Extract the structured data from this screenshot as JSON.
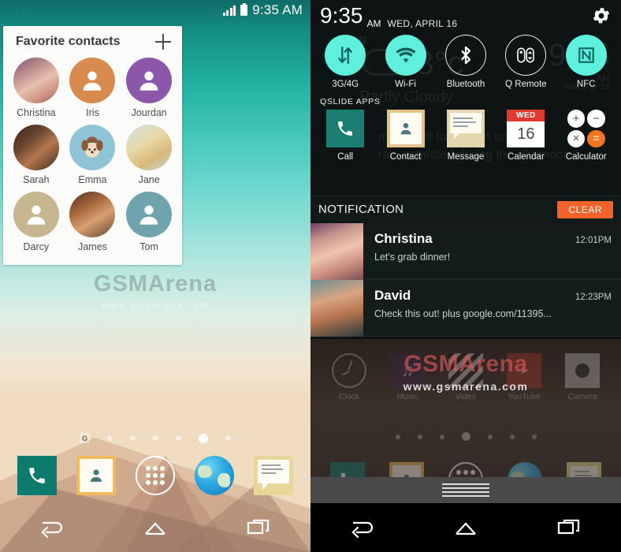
{
  "left_screen": {
    "statusbar": {
      "time": "9:35 AM",
      "signal_icon": "signal-bars-icon",
      "battery_icon": "battery-icon"
    },
    "widget": {
      "title": "Favorite contacts",
      "add_icon": "plus-icon",
      "contacts": [
        {
          "name": "Christina",
          "type": "photo",
          "photo_class": "ph-christina",
          "color": "#b98d8c"
        },
        {
          "name": "Iris",
          "type": "silhouette",
          "color": "#d98b4e"
        },
        {
          "name": "Jourdan",
          "type": "silhouette",
          "color": "#8c57ab"
        },
        {
          "name": "Sarah",
          "type": "photo",
          "photo_class": "ph-sarah",
          "color": "#6b4630"
        },
        {
          "name": "Emma",
          "type": "photo",
          "photo_class": "ph-emma",
          "color": "#8fc4d6"
        },
        {
          "name": "Jane",
          "type": "photo",
          "photo_class": "ph-jane",
          "color": "#d9b978"
        },
        {
          "name": "Darcy",
          "type": "silhouette",
          "color": "#c5b68f"
        },
        {
          "name": "James",
          "type": "photo",
          "photo_class": "ph-james",
          "color": "#a9683d"
        },
        {
          "name": "Tom",
          "type": "silhouette",
          "color": "#6fa3ae"
        }
      ]
    },
    "page_indicator": {
      "google_badge": "G",
      "dot_count": 6,
      "active_index": 5
    },
    "dock": [
      {
        "name": "phone",
        "icon": "phone-icon"
      },
      {
        "name": "contacts",
        "icon": "contact-icon"
      },
      {
        "name": "app-drawer",
        "icon": "app-drawer-icon"
      },
      {
        "name": "browser",
        "icon": "globe-icon"
      },
      {
        "name": "messages",
        "icon": "message-icon"
      }
    ],
    "navbar": [
      {
        "name": "back",
        "icon": "back-arrow-icon"
      },
      {
        "name": "home",
        "icon": "home-icon"
      },
      {
        "name": "recents",
        "icon": "recent-apps-icon"
      }
    ],
    "watermark": {
      "big": "GSMArena",
      "small": "www.gsmarena.com"
    }
  },
  "right_screen": {
    "header": {
      "time": "9:35",
      "ampm": "AM",
      "date": "WED, APRIL 16",
      "settings_icon": "gear-icon"
    },
    "ghost_widget": {
      "on": "ON",
      "temp": "13°c",
      "condition": "Partly Cloudy",
      "time": "9:35",
      "ampm": "AM",
      "date": "Wed, Apr 16",
      "line1": "may want to take an umbrella",
      "line2": "rain expected during the afternoon"
    },
    "toggles": [
      {
        "label": "3G/4G",
        "icon": "data-transfer-icon",
        "state": "on"
      },
      {
        "label": "Wi-Fi",
        "icon": "wifi-icon",
        "state": "on"
      },
      {
        "label": "Bluetooth",
        "icon": "bluetooth-icon",
        "state": "off"
      },
      {
        "label": "Q Remote",
        "icon": "remote-control-icon",
        "state": "off"
      },
      {
        "label": "NFC",
        "icon": "nfc-icon",
        "state": "on"
      }
    ],
    "qslide": {
      "title": "QSLIDE APPS",
      "apps": [
        {
          "label": "Call",
          "icon": "phone-icon"
        },
        {
          "label": "Contact",
          "icon": "contact-icon"
        },
        {
          "label": "Message",
          "icon": "message-icon"
        },
        {
          "label": "Calendar",
          "icon": "calendar-icon",
          "day": "WED",
          "date": "16"
        },
        {
          "label": "Calculator",
          "icon": "calculator-icon",
          "keys": [
            "+",
            "−",
            "×",
            "="
          ]
        }
      ]
    },
    "notification": {
      "title": "NOTIFICATION",
      "clear_label": "CLEAR",
      "items": [
        {
          "sender": "Christina",
          "message": "Let's grab dinner!",
          "time": "12:01PM",
          "photo_class": "np-christina"
        },
        {
          "sender": "David",
          "message": "Check this out! plus google.com/11395...",
          "time": "12:23PM",
          "photo_class": "np-david"
        }
      ]
    },
    "dim_home": {
      "apps": [
        {
          "label": "Clock",
          "icon": "clock-icon"
        },
        {
          "label": "Music",
          "icon": "music-icon"
        },
        {
          "label": "Video",
          "icon": "video-icon"
        },
        {
          "label": "YouTube",
          "icon": "youtube-icon"
        },
        {
          "label": "Camera",
          "icon": "camera-icon"
        }
      ],
      "dot_count": 7,
      "active_index": 3
    },
    "drag_handle": "drag-handle",
    "navbar": [
      {
        "name": "back",
        "icon": "back-arrow-icon"
      },
      {
        "name": "home",
        "icon": "home-icon"
      },
      {
        "name": "recents",
        "icon": "recent-apps-icon"
      }
    ],
    "watermark": {
      "big": "GSMArena",
      "small": "www.gsmarena.com"
    }
  },
  "colors": {
    "accent_cyan": "#5ef0dc",
    "shade_bg": "#0d1413",
    "clear_orange": "#f2622a",
    "calendar_red": "#e03a2f",
    "calc_orange": "#f47422"
  }
}
